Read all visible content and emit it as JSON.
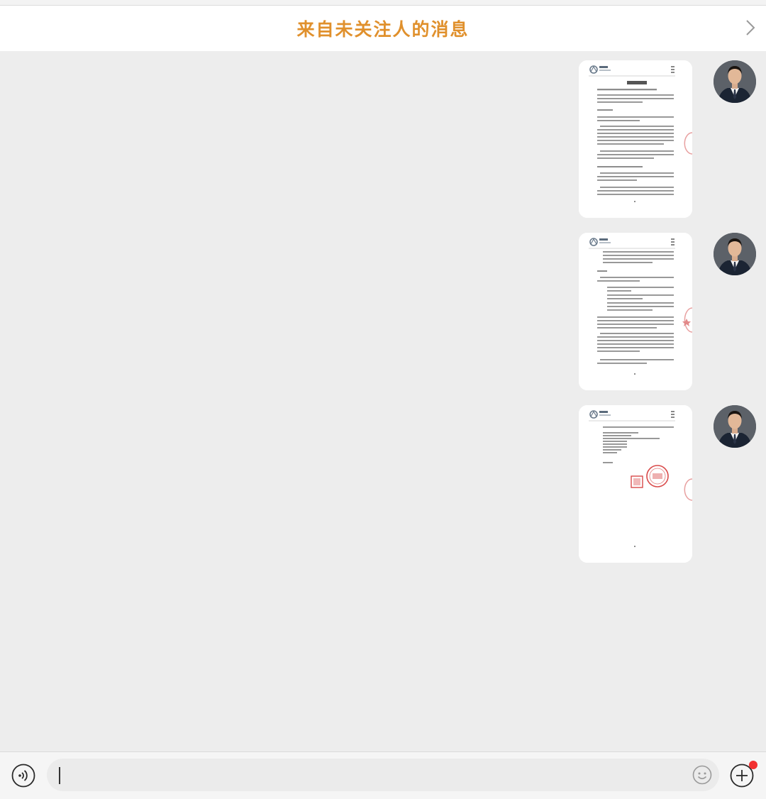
{
  "banner": {
    "title": "来自未关注人的消息",
    "chevron_icon": "chevron-right-icon"
  },
  "messages": [
    {
      "sender": "self",
      "type": "image",
      "content": "document-page-1",
      "stamp": "red-seal-partial"
    },
    {
      "sender": "self",
      "type": "image",
      "content": "document-page-2",
      "stamp": "red-seal-partial"
    },
    {
      "sender": "self",
      "type": "image",
      "content": "document-page-3",
      "stamp": "red-seal-signature"
    }
  ],
  "input_bar": {
    "text_value": "",
    "placeholder": "",
    "voice_icon": "voice-input-icon",
    "emoji_icon": "emoji-icon",
    "plus_icon": "plus-circle-icon",
    "has_notification_dot": true
  },
  "colors": {
    "title": "#e0902c",
    "chat_background": "#ededed",
    "notification_dot": "#f23030"
  }
}
